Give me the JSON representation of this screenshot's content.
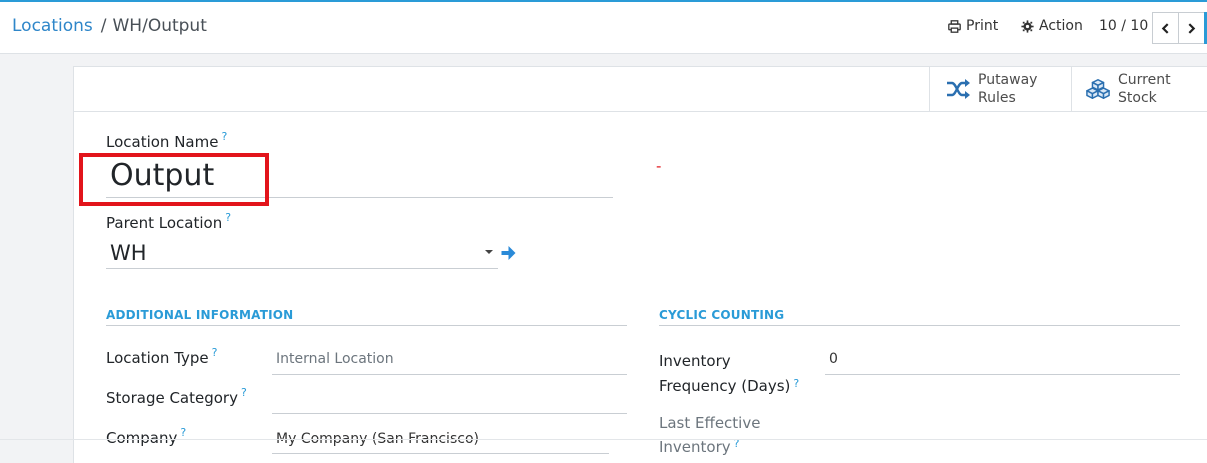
{
  "breadcrumb": {
    "parent": "Locations",
    "separator": "/",
    "current": "WH/Output"
  },
  "toolbar": {
    "print_label": "Print",
    "action_label": "Action",
    "pager": "10 / 10"
  },
  "smart_buttons": {
    "putaway": {
      "line1": "Putaway",
      "line2": "Rules",
      "icon": "shuffle-icon"
    },
    "stock": {
      "line1": "Current",
      "line2": "Stock",
      "icon": "cubes-icon"
    }
  },
  "form": {
    "location_name_label": "Location Name",
    "location_name_value": "Output",
    "required_marker": "-",
    "parent_location_label": "Parent Location",
    "parent_location_value": "WH",
    "help_mark": "?"
  },
  "additional_info": {
    "title": "ADDITIONAL INFORMATION",
    "location_type_label": "Location Type",
    "location_type_value": "Internal Location",
    "storage_category_label": "Storage Category",
    "storage_category_value": "",
    "company_label": "Company",
    "company_value": "My Company (San Francisco)"
  },
  "cyclic_counting": {
    "title": "CYCLIC COUNTING",
    "inventory_freq_label_1": "Inventory",
    "inventory_freq_label_2": "Frequency (Days)",
    "inventory_freq_value": "0",
    "last_effective_label_1": "Last Effective",
    "last_effective_label_2": "Inventory"
  },
  "colors": {
    "accent": "#2a9bd7",
    "link": "#2e86c9",
    "highlight": "#e2141b"
  }
}
